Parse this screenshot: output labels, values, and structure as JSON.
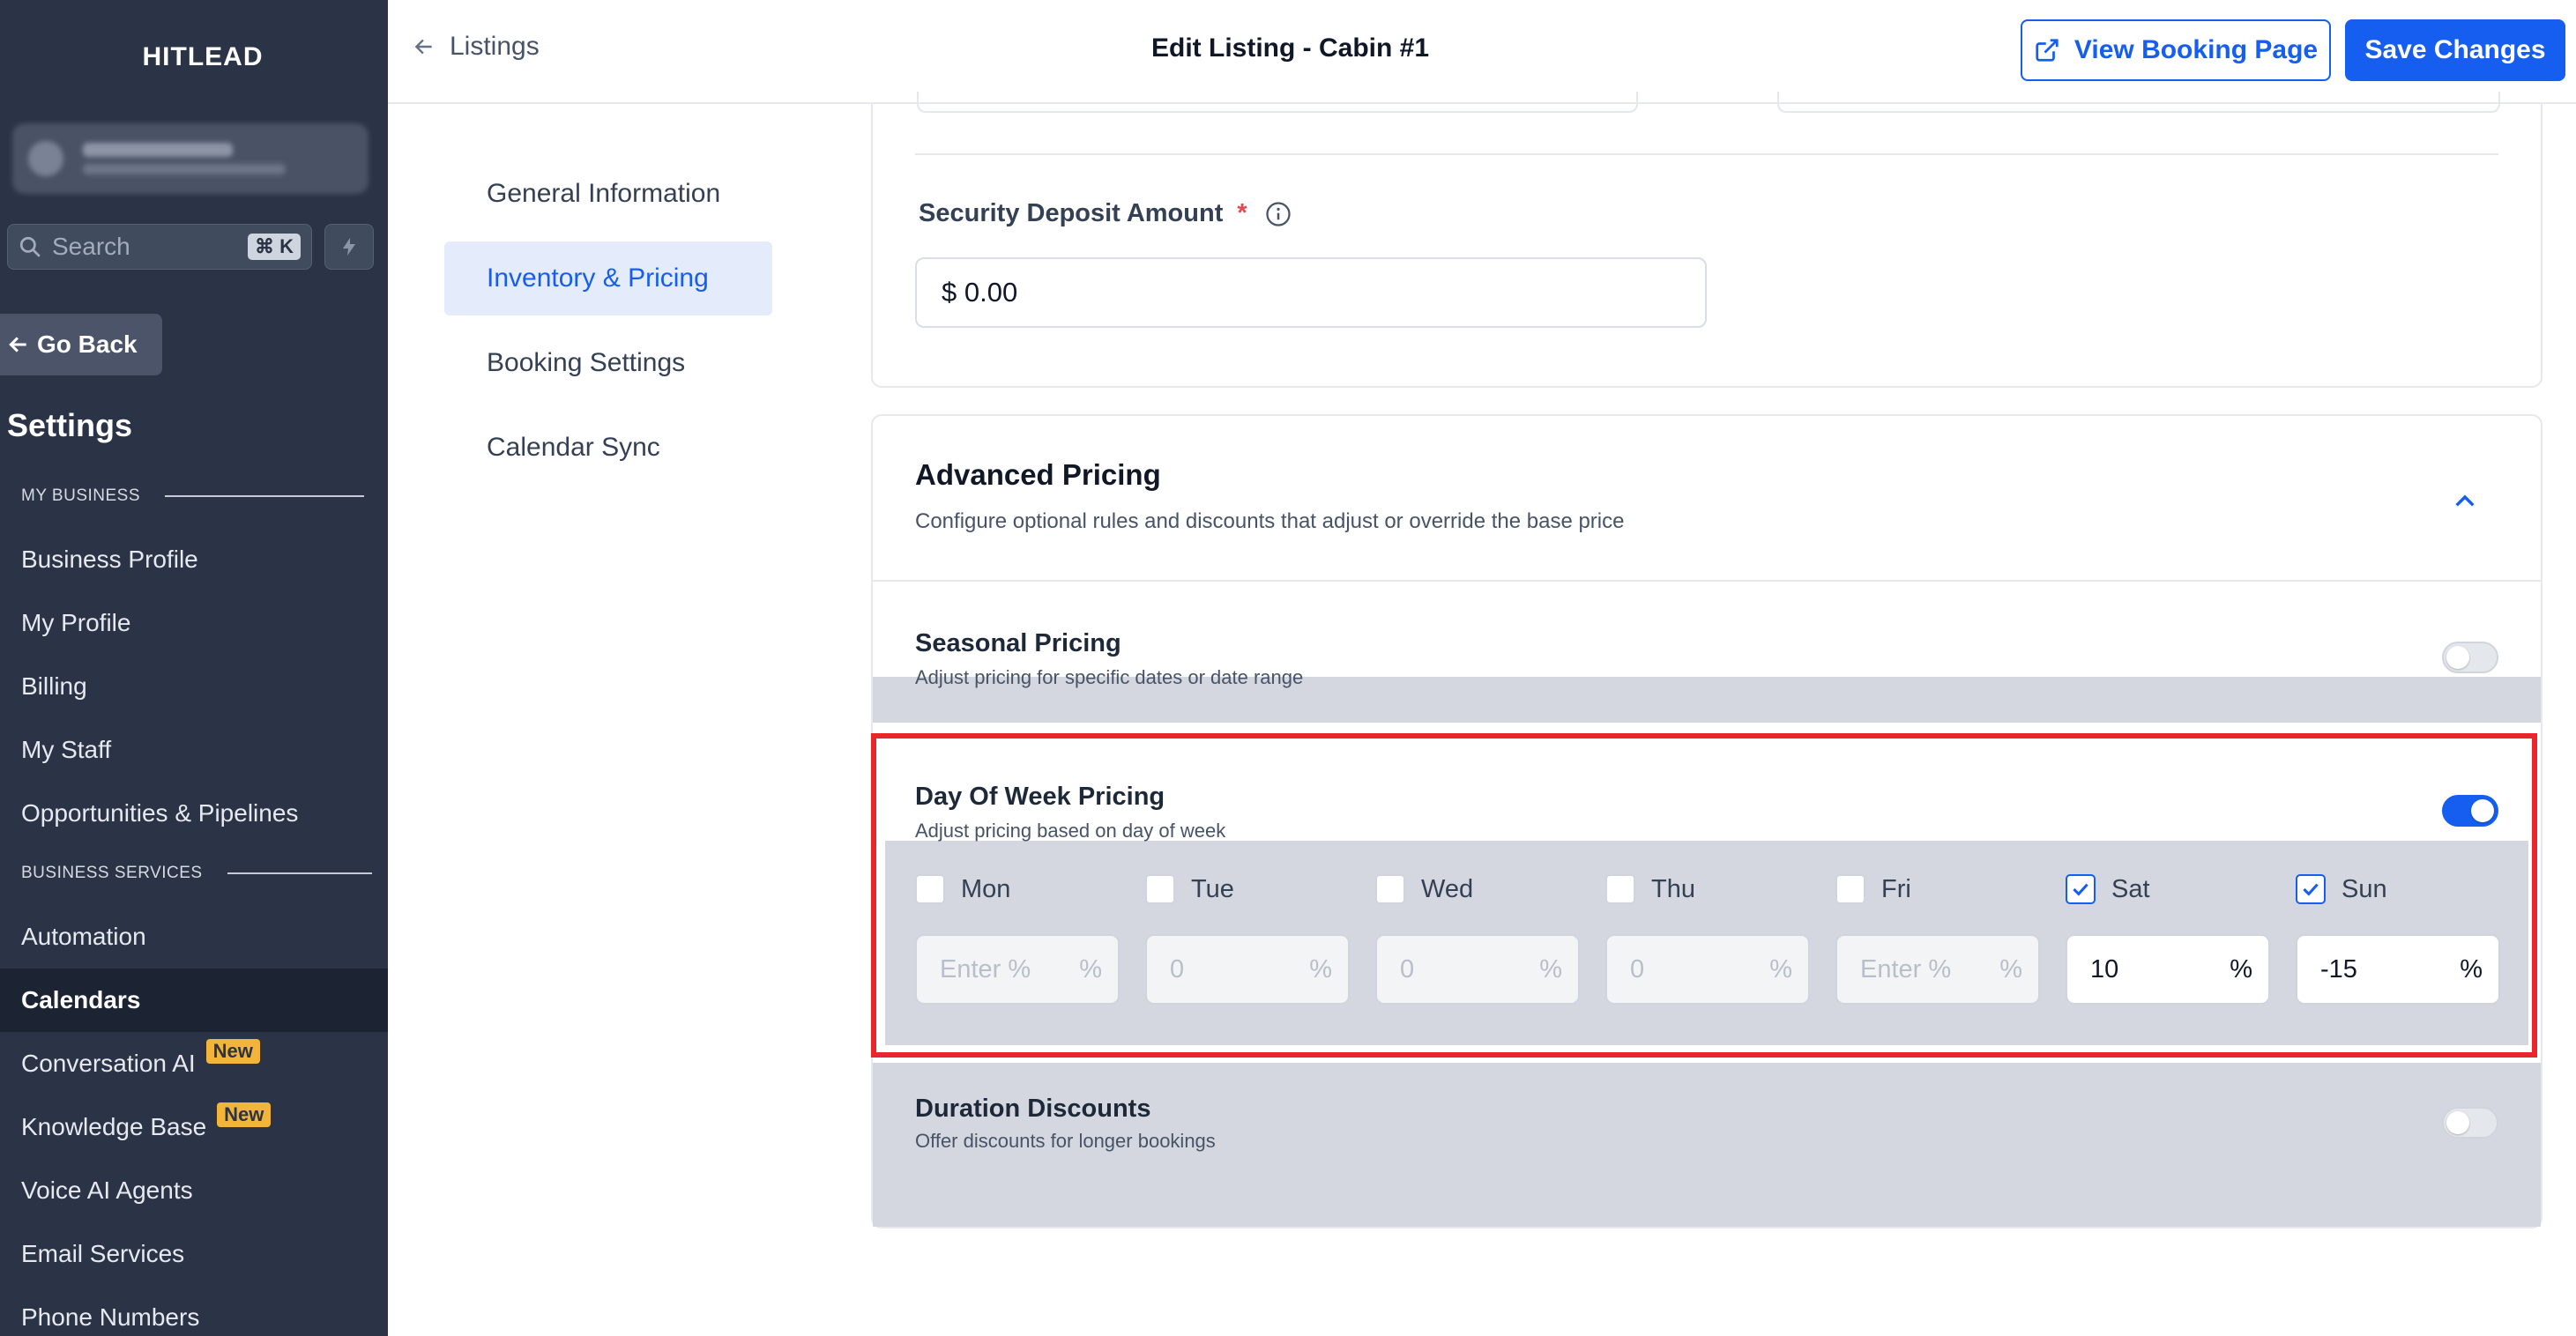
{
  "sidebar": {
    "brand": "HITLEAD",
    "search_placeholder": "Search",
    "search_shortcut": "⌘ K",
    "go_back": "Go Back",
    "settings_title": "Settings",
    "section_my_business": "MY BUSINESS",
    "section_business_services": "BUSINESS SERVICES",
    "items": [
      {
        "label": "Business Profile"
      },
      {
        "label": "My Profile"
      },
      {
        "label": "Billing"
      },
      {
        "label": "My Staff"
      },
      {
        "label": "Opportunities & Pipelines"
      },
      {
        "label": "Automation"
      },
      {
        "label": "Calendars",
        "active": true
      },
      {
        "label": "Conversation AI",
        "badge": "New"
      },
      {
        "label": "Knowledge Base",
        "badge": "New"
      },
      {
        "label": "Voice AI Agents"
      },
      {
        "label": "Email Services"
      },
      {
        "label": "Phone Numbers"
      }
    ]
  },
  "header": {
    "back_label": "Listings",
    "title": "Edit Listing - Cabin #1",
    "view_booking_label": "View Booking Page",
    "save_label": "Save Changes"
  },
  "subnav": {
    "items": [
      {
        "label": "General Information"
      },
      {
        "label": "Inventory & Pricing",
        "active": true
      },
      {
        "label": "Booking Settings"
      },
      {
        "label": "Calendar Sync"
      }
    ]
  },
  "deposit": {
    "label": "Security Deposit Amount",
    "required_mark": "*",
    "value": "$ 0.00"
  },
  "advanced": {
    "title": "Advanced Pricing",
    "subtitle": "Configure optional rules and discounts that adjust or override the base price",
    "seasonal": {
      "title": "Seasonal Pricing",
      "subtitle": "Adjust pricing for specific dates or date range",
      "enabled": false
    },
    "day_of_week": {
      "title": "Day Of Week Pricing",
      "subtitle": "Adjust pricing based on day of week",
      "enabled": true,
      "unit": "%",
      "days": [
        {
          "label": "Mon",
          "checked": false,
          "value": "Enter %",
          "is_placeholder": true
        },
        {
          "label": "Tue",
          "checked": false,
          "value": "0",
          "is_placeholder": false
        },
        {
          "label": "Wed",
          "checked": false,
          "value": "0",
          "is_placeholder": false
        },
        {
          "label": "Thu",
          "checked": false,
          "value": "0",
          "is_placeholder": false
        },
        {
          "label": "Fri",
          "checked": false,
          "value": "Enter %",
          "is_placeholder": true
        },
        {
          "label": "Sat",
          "checked": true,
          "value": "10",
          "is_placeholder": false
        },
        {
          "label": "Sun",
          "checked": true,
          "value": "-15",
          "is_placeholder": false
        }
      ]
    },
    "duration": {
      "title": "Duration Discounts",
      "subtitle": "Offer discounts for longer bookings",
      "enabled": false
    }
  },
  "colors": {
    "accent": "#155eef",
    "sidebar_bg": "#2b3446",
    "highlight": "#e8262b",
    "badge": "#f2b53a"
  }
}
